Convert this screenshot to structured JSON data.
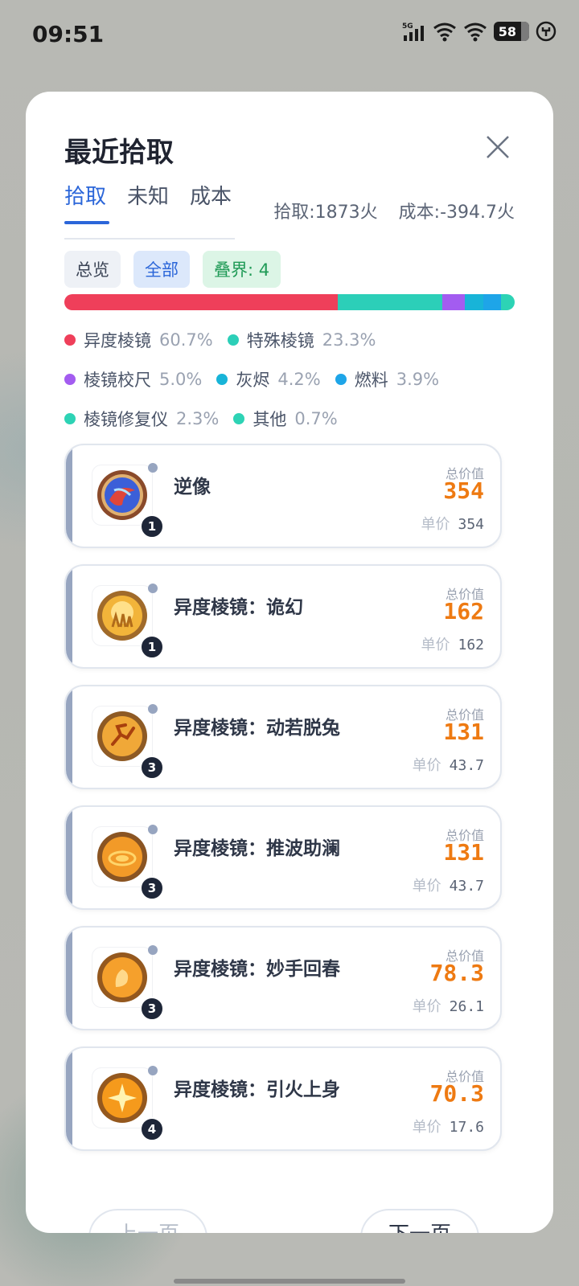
{
  "status_bar": {
    "time": "09:51",
    "network": "5G",
    "battery": "58"
  },
  "modal": {
    "title": "最近拾取",
    "tabs": [
      "拾取",
      "未知",
      "成本"
    ],
    "summary_pickup": "拾取:1873火",
    "summary_cost": "成本:-394.7火",
    "chips": {
      "overview": "总览",
      "all": "全部",
      "layer": "叠界: 4"
    }
  },
  "distribution": [
    {
      "name": "异度棱镜",
      "pct": "60.7%",
      "value": 60.7,
      "color": "#ef3f5a"
    },
    {
      "name": "特殊棱镜",
      "pct": "23.3%",
      "value": 23.3,
      "color": "#2ccfb8"
    },
    {
      "name": "棱镜校尺",
      "pct": "5.0%",
      "value": 5.0,
      "color": "#a35cf0"
    },
    {
      "name": "灰烬",
      "pct": "4.2%",
      "value": 4.2,
      "color": "#18b4d8"
    },
    {
      "name": "燃料",
      "pct": "3.9%",
      "value": 3.9,
      "color": "#1ea5e8"
    },
    {
      "name": "棱镜修复仪",
      "pct": "2.3%",
      "value": 2.3,
      "color": "#2dd3b5"
    },
    {
      "name": "其他",
      "pct": "0.7%",
      "value": 0.7,
      "color": "#2dd3b5"
    }
  ],
  "items": [
    {
      "name": "逆像",
      "count": "1",
      "total_label": "总价值",
      "total": "354",
      "unit_label": "单价",
      "unit": "354",
      "icon": "swirl-orb-icon"
    },
    {
      "name": "异度棱镜：诡幻",
      "count": "1",
      "total_label": "总价值",
      "total": "162",
      "unit_label": "单价",
      "unit": "162",
      "icon": "ghost-orb-icon"
    },
    {
      "name": "异度棱镜：动若脱兔",
      "count": "3",
      "total_label": "总价值",
      "total": "131",
      "unit_label": "单价",
      "unit": "43.7",
      "icon": "runner-orb-icon"
    },
    {
      "name": "异度棱镜：推波助澜",
      "count": "3",
      "total_label": "总价值",
      "total": "131",
      "unit_label": "单价",
      "unit": "43.7",
      "icon": "wave-orb-icon"
    },
    {
      "name": "异度棱镜：妙手回春",
      "count": "3",
      "total_label": "总价值",
      "total": "78.3",
      "unit_label": "单价",
      "unit": "26.1",
      "icon": "hand-orb-icon"
    },
    {
      "name": "异度棱镜：引火上身",
      "count": "4",
      "total_label": "总价值",
      "total": "70.3",
      "unit_label": "单价",
      "unit": "17.6",
      "icon": "fire-orb-icon"
    }
  ],
  "pager": {
    "prev": "上一页",
    "next": "下一页"
  }
}
